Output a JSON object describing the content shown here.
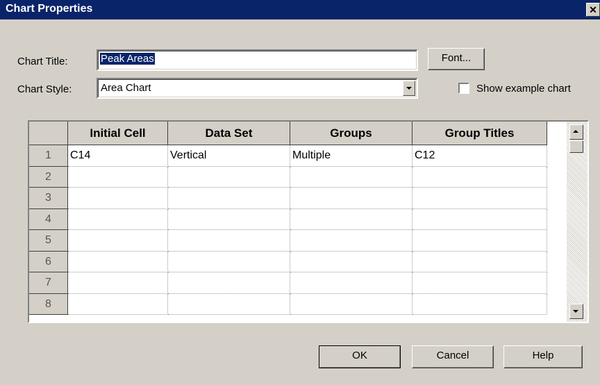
{
  "window": {
    "title": "Chart Properties",
    "close_glyph": "✕"
  },
  "form": {
    "chart_title_label": "Chart Title:",
    "chart_title_value": "Peak Areas",
    "font_button": "Font...",
    "chart_style_label": "Chart Style:",
    "chart_style_value": "Area Chart",
    "show_example_label": "Show example chart",
    "show_example_checked": false
  },
  "grid": {
    "columns": [
      "Initial Cell",
      "Data Set",
      "Groups",
      "Group Titles"
    ],
    "rows": [
      {
        "num": "1",
        "cells": [
          "C14",
          "Vertical",
          "Multiple",
          "C12"
        ]
      },
      {
        "num": "2",
        "cells": [
          "",
          "",
          "",
          ""
        ]
      },
      {
        "num": "3",
        "cells": [
          "",
          "",
          "",
          ""
        ]
      },
      {
        "num": "4",
        "cells": [
          "",
          "",
          "",
          ""
        ]
      },
      {
        "num": "5",
        "cells": [
          "",
          "",
          "",
          ""
        ]
      },
      {
        "num": "6",
        "cells": [
          "",
          "",
          "",
          ""
        ]
      },
      {
        "num": "7",
        "cells": [
          "",
          "",
          "",
          ""
        ]
      },
      {
        "num": "8",
        "cells": [
          "",
          "",
          "",
          ""
        ]
      }
    ]
  },
  "buttons": {
    "ok": "OK",
    "cancel": "Cancel",
    "help": "Help"
  },
  "colors": {
    "titlebar": "#0a246a",
    "face": "#d4d0c8",
    "field": "#ffffff"
  }
}
